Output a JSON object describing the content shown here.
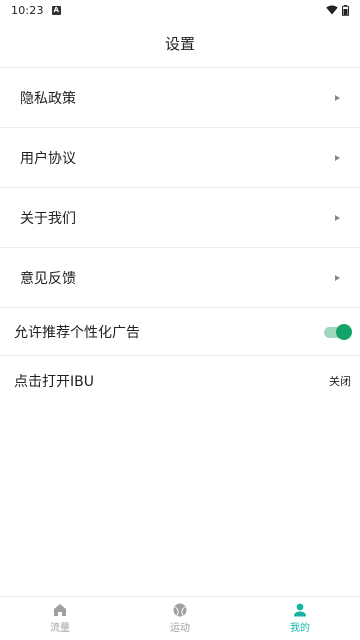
{
  "status_bar": {
    "time": "10:23",
    "notification_glyph": "A"
  },
  "header": {
    "title": "设置"
  },
  "menu": {
    "items": [
      {
        "label": "隐私政策"
      },
      {
        "label": "用户协议"
      },
      {
        "label": "关于我们"
      },
      {
        "label": "意见反馈"
      }
    ]
  },
  "personalized_ads": {
    "label": "允许推荐个性化广告",
    "enabled": true
  },
  "ibu": {
    "label": "点击打开IBU",
    "state": "关闭"
  },
  "tabbar": {
    "tabs": [
      {
        "label": "流量",
        "icon": "home-icon",
        "active": false
      },
      {
        "label": "运动",
        "icon": "sport-ball-icon",
        "active": false
      },
      {
        "label": "我的",
        "icon": "person-icon",
        "active": true
      }
    ]
  },
  "colors": {
    "accent": "#14b3a6",
    "switch_on": "#12a36b",
    "switch_track": "#9fd8bd",
    "divider": "#ececec"
  }
}
